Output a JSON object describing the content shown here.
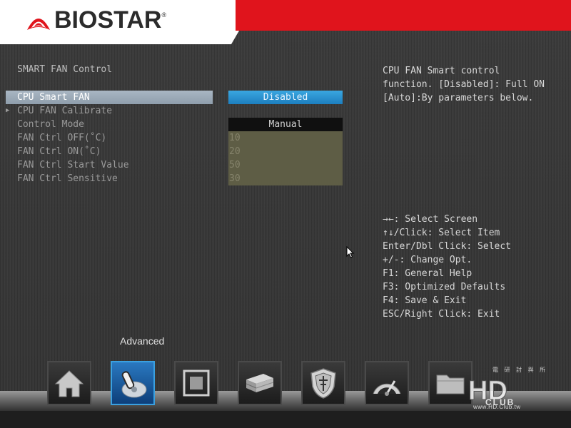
{
  "header": {
    "logo_text": "BIOSTAR",
    "logo_reg": "®"
  },
  "page": {
    "section_title": "SMART FAN Control"
  },
  "menu": [
    {
      "label": "CPU Smart FAN",
      "selected": true,
      "has_arrow": false
    },
    {
      "label": "CPU FAN Calibrate",
      "selected": false,
      "has_arrow": true
    },
    {
      "label": "Control Mode",
      "selected": false,
      "has_arrow": false
    },
    {
      "label": "FAN Ctrl OFF(˚C)",
      "selected": false,
      "has_arrow": false
    },
    {
      "label": "FAN Ctrl ON(˚C)",
      "selected": false,
      "has_arrow": false
    },
    {
      "label": "FAN Ctrl Start Value",
      "selected": false,
      "has_arrow": false
    },
    {
      "label": "FAN Ctrl Sensitive",
      "selected": false,
      "has_arrow": false
    }
  ],
  "values": {
    "cpu_smart_fan": "Disabled",
    "control_mode": "Manual",
    "fan_ctrl_off": "10",
    "fan_ctrl_on": "20",
    "fan_ctrl_start_value": "50",
    "fan_ctrl_sensitive": "30"
  },
  "help_text": "CPU FAN Smart control\nfunction. [Disabled]: Full ON\n[Auto]:By parameters below.",
  "key_help": [
    "→←: Select Screen",
    "↑↓/Click: Select Item",
    "Enter/Dbl Click: Select",
    "+/-: Change Opt.",
    "F1: General Help",
    "F3: Optimized Defaults",
    "F4: Save & Exit",
    "ESC/Right Click: Exit"
  ],
  "dock": {
    "active_tab_label": "Advanced",
    "tabs": [
      {
        "icon": "home-icon",
        "active": false
      },
      {
        "icon": "joystick-icon",
        "active": true
      },
      {
        "icon": "chipset-icon",
        "active": false
      },
      {
        "icon": "boot-drive-icon",
        "active": false
      },
      {
        "icon": "security-shield-icon",
        "active": false
      },
      {
        "icon": "speedometer-icon",
        "active": false
      },
      {
        "icon": "folder-exit-icon",
        "active": false
      }
    ]
  },
  "watermark": {
    "url": "www.HD.Club.tw",
    "cn": "電 研 討 與 所",
    "logo_text": "HD CLUB"
  },
  "colors": {
    "header_red": "#e0141c",
    "selected_value_blue": "#2a92d2",
    "olive_field": "#5e5d45",
    "active_tab_blue": "#1f63a8"
  }
}
